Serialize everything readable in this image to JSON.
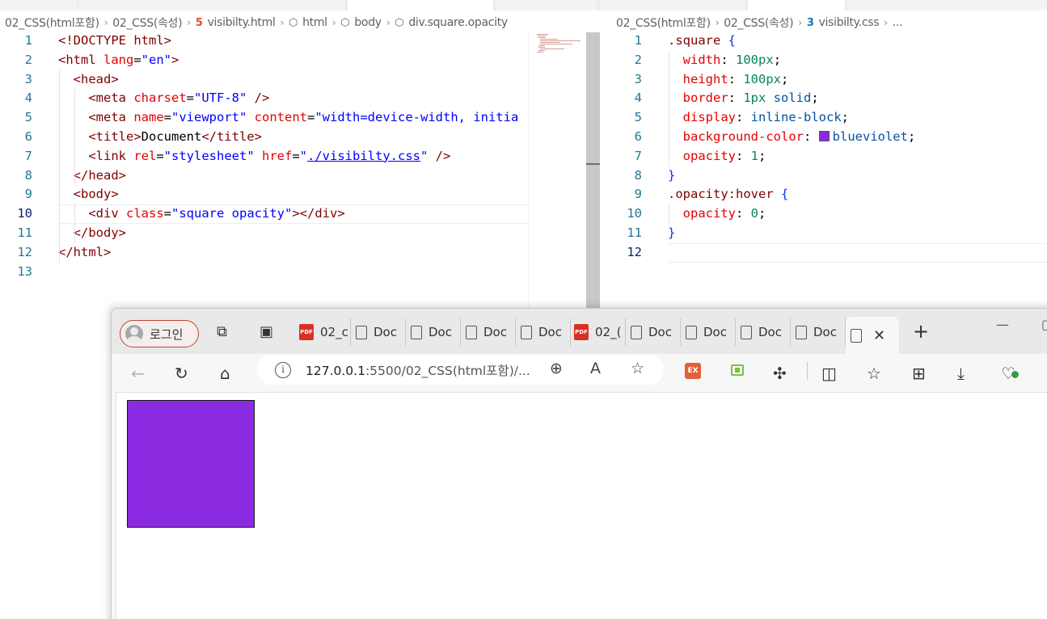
{
  "editor_left": {
    "breadcrumb": [
      "02_CSS(html포함)",
      "02_CSS(속성)",
      "visibilty.html",
      "html",
      "body",
      "div.square.opacity"
    ],
    "lines": [
      {
        "n": "1",
        "tokens": [
          [
            "t-tag",
            "<!DOCTYPE html>"
          ]
        ]
      },
      {
        "n": "2",
        "tokens": [
          [
            "t-tag",
            "<html "
          ],
          [
            "t-attr",
            "lang"
          ],
          [
            "t-plain",
            "="
          ],
          [
            "t-str",
            "\"en\""
          ],
          [
            "t-tag",
            ">"
          ]
        ]
      },
      {
        "n": "3",
        "tokens": [
          [
            "t-plain",
            "  "
          ],
          [
            "t-tag",
            "<head>"
          ]
        ]
      },
      {
        "n": "4",
        "tokens": [
          [
            "t-plain",
            "    "
          ],
          [
            "t-tag",
            "<meta "
          ],
          [
            "t-attr",
            "charset"
          ],
          [
            "t-plain",
            "="
          ],
          [
            "t-str",
            "\"UTF-8\""
          ],
          [
            "t-tag",
            " />"
          ]
        ]
      },
      {
        "n": "5",
        "tokens": [
          [
            "t-plain",
            "    "
          ],
          [
            "t-tag",
            "<meta "
          ],
          [
            "t-attr",
            "name"
          ],
          [
            "t-plain",
            "="
          ],
          [
            "t-str",
            "\"viewport\""
          ],
          [
            "t-plain",
            " "
          ],
          [
            "t-attr",
            "content"
          ],
          [
            "t-plain",
            "="
          ],
          [
            "t-str",
            "\"width=device-width, initia"
          ]
        ]
      },
      {
        "n": "6",
        "tokens": [
          [
            "t-plain",
            "    "
          ],
          [
            "t-tag",
            "<title>"
          ],
          [
            "t-plain",
            "Document"
          ],
          [
            "t-tag",
            "</title>"
          ]
        ]
      },
      {
        "n": "7",
        "tokens": [
          [
            "t-plain",
            "    "
          ],
          [
            "t-tag",
            "<link "
          ],
          [
            "t-attr",
            "rel"
          ],
          [
            "t-plain",
            "="
          ],
          [
            "t-str",
            "\"stylesheet\""
          ],
          [
            "t-plain",
            " "
          ],
          [
            "t-attr",
            "href"
          ],
          [
            "t-plain",
            "="
          ],
          [
            "t-str",
            "\""
          ],
          [
            "t-link",
            "./visibilty.css"
          ],
          [
            "t-str",
            "\""
          ],
          [
            "t-tag",
            " />"
          ]
        ]
      },
      {
        "n": "8",
        "tokens": [
          [
            "t-plain",
            "  "
          ],
          [
            "t-tag",
            "</head>"
          ]
        ]
      },
      {
        "n": "9",
        "tokens": [
          [
            "t-plain",
            "  "
          ],
          [
            "t-tag",
            "<body>"
          ]
        ]
      },
      {
        "n": "10",
        "tokens": [
          [
            "t-plain",
            "    "
          ],
          [
            "t-tag",
            "<div "
          ],
          [
            "t-attr",
            "class"
          ],
          [
            "t-plain",
            "="
          ],
          [
            "t-str",
            "\"square opacity\""
          ],
          [
            "t-tag",
            "></div>"
          ]
        ]
      },
      {
        "n": "11",
        "tokens": [
          [
            "t-plain",
            "  "
          ],
          [
            "t-tag",
            "</body>"
          ]
        ]
      },
      {
        "n": "12",
        "tokens": [
          [
            "t-tag",
            "</html>"
          ]
        ]
      },
      {
        "n": "13",
        "tokens": []
      }
    ],
    "current_line": "10"
  },
  "editor_right": {
    "breadcrumb": [
      "02_CSS(html포함)",
      "02_CSS(속성)",
      "visibilty.css",
      "..."
    ],
    "lines": [
      {
        "n": "1",
        "tokens": [
          [
            "t-sel",
            ".square"
          ],
          [
            "t-plain",
            " "
          ],
          [
            "t-brace",
            "{"
          ]
        ]
      },
      {
        "n": "2",
        "tokens": [
          [
            "t-plain",
            "  "
          ],
          [
            "t-prop",
            "width"
          ],
          [
            "t-plain",
            ": "
          ],
          [
            "t-num",
            "100px"
          ],
          [
            "t-plain",
            ";"
          ]
        ]
      },
      {
        "n": "3",
        "tokens": [
          [
            "t-plain",
            "  "
          ],
          [
            "t-prop",
            "height"
          ],
          [
            "t-plain",
            ": "
          ],
          [
            "t-num",
            "100px"
          ],
          [
            "t-plain",
            ";"
          ]
        ]
      },
      {
        "n": "4",
        "tokens": [
          [
            "t-plain",
            "  "
          ],
          [
            "t-prop",
            "border"
          ],
          [
            "t-plain",
            ": "
          ],
          [
            "t-num",
            "1px"
          ],
          [
            "t-plain",
            " "
          ],
          [
            "t-val",
            "solid"
          ],
          [
            "t-plain",
            ";"
          ]
        ]
      },
      {
        "n": "5",
        "tokens": [
          [
            "t-plain",
            "  "
          ],
          [
            "t-prop",
            "display"
          ],
          [
            "t-plain",
            ": "
          ],
          [
            "t-val",
            "inline-block"
          ],
          [
            "t-plain",
            ";"
          ]
        ]
      },
      {
        "n": "6",
        "tokens": [
          [
            "t-plain",
            "  "
          ],
          [
            "t-prop",
            "background-color"
          ],
          [
            "t-plain",
            ": "
          ],
          [
            "swatch",
            ""
          ],
          [
            "t-val",
            "blueviolet"
          ],
          [
            "t-plain",
            ";"
          ]
        ]
      },
      {
        "n": "7",
        "tokens": [
          [
            "t-plain",
            "  "
          ],
          [
            "t-prop",
            "opacity"
          ],
          [
            "t-plain",
            ": "
          ],
          [
            "t-num",
            "1"
          ],
          [
            "t-plain",
            ";"
          ]
        ]
      },
      {
        "n": "8",
        "tokens": [
          [
            "t-brace",
            "}"
          ]
        ]
      },
      {
        "n": "9",
        "tokens": [
          [
            "t-sel",
            ".opacity:hover"
          ],
          [
            "t-plain",
            " "
          ],
          [
            "t-brace",
            "{"
          ]
        ]
      },
      {
        "n": "10",
        "tokens": [
          [
            "t-plain",
            "  "
          ],
          [
            "t-prop",
            "opacity"
          ],
          [
            "t-plain",
            ": "
          ],
          [
            "t-num",
            "0"
          ],
          [
            "t-plain",
            ";"
          ]
        ]
      },
      {
        "n": "11",
        "tokens": [
          [
            "t-brace",
            "}"
          ]
        ]
      },
      {
        "n": "12",
        "tokens": []
      }
    ],
    "current_line": "12"
  },
  "browser": {
    "login_label": "로그인",
    "tabs": [
      {
        "icon": "pdf",
        "label": "02_c"
      },
      {
        "icon": "doc",
        "label": "Doc"
      },
      {
        "icon": "doc",
        "label": "Doc"
      },
      {
        "icon": "doc",
        "label": "Doc"
      },
      {
        "icon": "doc",
        "label": "Doc"
      },
      {
        "icon": "pdf",
        "label": "02_("
      },
      {
        "icon": "doc",
        "label": "Doc"
      },
      {
        "icon": "doc",
        "label": "Doc"
      },
      {
        "icon": "doc",
        "label": "Doc"
      },
      {
        "icon": "doc",
        "label": "Doc"
      }
    ],
    "address": {
      "host": "127.0.0.1",
      "rest": ":5500/02_CSS(html포함)/..."
    },
    "ext_label": "EX",
    "pdf_badge": "PDF",
    "square_color": "#8a2be2"
  }
}
